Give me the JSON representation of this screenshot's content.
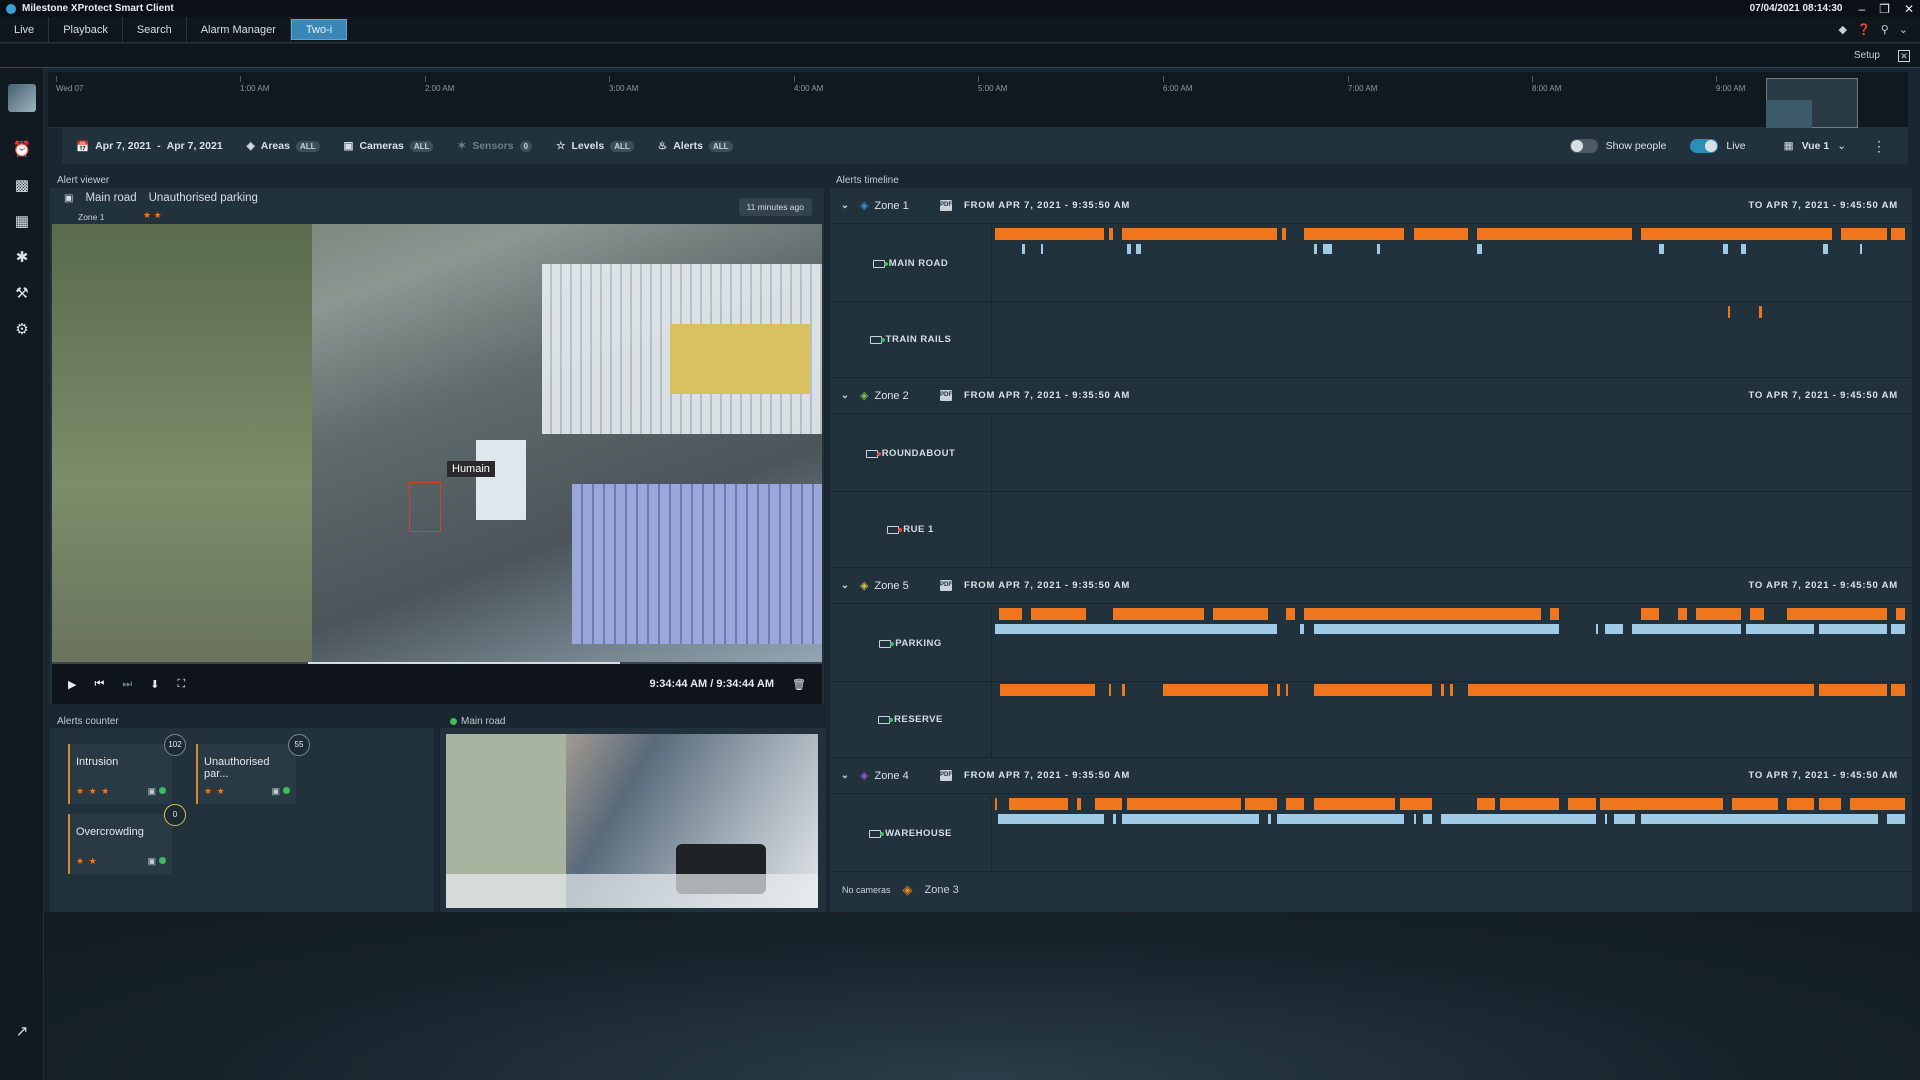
{
  "app": {
    "title": "Milestone XProtect Smart Client",
    "datetime": "07/04/2021 08:14:30"
  },
  "menu": {
    "tabs": [
      "Live",
      "Playback",
      "Search",
      "Alarm Manager",
      "Two-i"
    ],
    "active": "Two-i",
    "setup": "Setup"
  },
  "ruler": {
    "ticks": [
      "Wed 07",
      "1:00 AM",
      "2:00 AM",
      "3:00 AM",
      "4:00 AM",
      "5:00 AM",
      "6:00 AM",
      "7:00 AM",
      "8:00 AM",
      "9:00 AM"
    ]
  },
  "filters": {
    "date_from": "Apr 7, 2021",
    "date_sep": "-",
    "date_to": "Apr 7, 2021",
    "areas": {
      "label": "Areas",
      "pill": "ALL"
    },
    "cameras": {
      "label": "Cameras",
      "pill": "ALL"
    },
    "sensors": {
      "label": "Sensors",
      "pill": "0"
    },
    "levels": {
      "label": "Levels",
      "pill": "ALL"
    },
    "alerts": {
      "label": "Alerts",
      "pill": "ALL"
    },
    "show_people": "Show people",
    "live": "Live",
    "view": "Vue 1"
  },
  "alert_viewer": {
    "label": "Alert viewer",
    "camera": "Main road",
    "alert_type": "Unauthorised parking",
    "zone": "Zone 1",
    "stars": "★ ★",
    "ago": "11 minutes ago",
    "detection_label": "Humain",
    "time": "9:34:44 AM / 9:34:44 AM"
  },
  "counter": {
    "label": "Alerts counter",
    "cards": [
      {
        "name": "Intrusion",
        "count": "102",
        "stars": "★ ★ ★"
      },
      {
        "name": "Unauthorised par...",
        "count": "55",
        "stars": "★ ★"
      },
      {
        "name": "Overcrowding",
        "count": "0",
        "stars": "★ ★"
      }
    ]
  },
  "mini_cam": {
    "label": "Main road"
  },
  "timeline": {
    "label": "Alerts timeline",
    "zones": [
      {
        "name": "Zone 1",
        "from": "FROM APR 7, 2021 - 9:35:50 AM",
        "to": "TO APR 7, 2021 - 9:45:50 AM",
        "icon_color": "#3a8fd0",
        "cameras": [
          {
            "name": "MAIN ROAD",
            "status": "green"
          },
          {
            "name": "TRAIN RAILS",
            "status": "green"
          }
        ]
      },
      {
        "name": "Zone 2",
        "from": "FROM APR 7, 2021 - 9:35:50 AM",
        "to": "TO APR 7, 2021 - 9:45:50 AM",
        "icon_color": "#7fbf5a",
        "cameras": [
          {
            "name": "ROUNDABOUT",
            "status": "red"
          },
          {
            "name": "RUE 1",
            "status": "red"
          }
        ]
      },
      {
        "name": "Zone 5",
        "from": "FROM APR 7, 2021 - 9:35:50 AM",
        "to": "TO APR 7, 2021 - 9:45:50 AM",
        "icon_color": "#d9c34a",
        "cameras": [
          {
            "name": "PARKING",
            "status": "green"
          },
          {
            "name": "RESERVE",
            "status": "green"
          }
        ]
      },
      {
        "name": "Zone 4",
        "from": "FROM APR 7, 2021 - 9:35:50 AM",
        "to": "TO APR 7, 2021 - 9:45:50 AM",
        "icon_color": "#8a5ac8",
        "cameras": [
          {
            "name": "WAREHOUSE",
            "status": "green"
          }
        ]
      }
    ],
    "no_cameras": {
      "label": "No cameras",
      "zone": "Zone 3"
    }
  },
  "colors": {
    "accent": "#3a86b6",
    "alert_orange": "#f0761d",
    "track_blue": "#9fcbe6",
    "ok_green": "#3dbd5d"
  }
}
